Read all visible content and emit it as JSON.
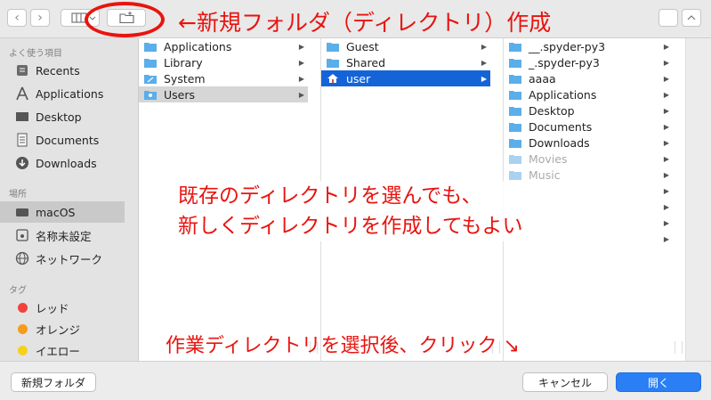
{
  "toolbar": {
    "back_icon": "chevron-left",
    "forward_icon": "chevron-right",
    "view_icon": "columns-view",
    "new_folder_icon": "new-folder"
  },
  "annotations": {
    "new_folder": "←新規フォルダ（ディレクトリ）作成",
    "middle_line1": "既存のディレクトリを選んでも、",
    "middle_line2": "新しくディレクトリを作成してもよい",
    "bottom": "作業ディレクトリを選択後、クリック ↘",
    "color": "#e8140f"
  },
  "sidebar": {
    "favorites_header": "よく使う項目",
    "favorites": [
      {
        "label": "Recents",
        "icon": "clock-icon"
      },
      {
        "label": "Applications",
        "icon": "applications-icon"
      },
      {
        "label": "Desktop",
        "icon": "desktop-icon"
      },
      {
        "label": "Documents",
        "icon": "document-icon"
      },
      {
        "label": "Downloads",
        "icon": "download-icon"
      }
    ],
    "locations_header": "場所",
    "locations": [
      {
        "label": "macOS",
        "icon": "disk-icon",
        "selected": true
      },
      {
        "label": "名称未設定",
        "icon": "disk-icon"
      },
      {
        "label": "ネットワーク",
        "icon": "globe-icon"
      }
    ],
    "tags_header": "タグ",
    "tags": [
      {
        "label": "レッド",
        "color": "#f0433a"
      },
      {
        "label": "オレンジ",
        "color": "#f89a1c"
      },
      {
        "label": "イエロー",
        "color": "#f6d11c"
      }
    ]
  },
  "columns": {
    "col1": [
      {
        "label": "Applications",
        "icon": "applications-icon",
        "arrow": true
      },
      {
        "label": "Library",
        "icon": "folder-icon",
        "arrow": true
      },
      {
        "label": "System",
        "icon": "system-icon",
        "arrow": true
      },
      {
        "label": "Users",
        "icon": "users-icon",
        "arrow": true,
        "state": "gray"
      }
    ],
    "col2": [
      {
        "label": "Guest",
        "icon": "folder-icon",
        "arrow": true
      },
      {
        "label": "Shared",
        "icon": "folder-icon",
        "arrow": true
      },
      {
        "label": "user",
        "icon": "home-icon",
        "arrow": true,
        "state": "selected"
      }
    ],
    "col3": [
      {
        "label": "__.spyder-py3",
        "icon": "folder-icon",
        "arrow": true
      },
      {
        "label": "_.spyder-py3",
        "icon": "folder-icon",
        "arrow": true
      },
      {
        "label": "aaaa",
        "icon": "folder-icon",
        "arrow": true
      },
      {
        "label": "Applications",
        "icon": "folder-icon",
        "arrow": true
      },
      {
        "label": "Desktop",
        "icon": "folder-icon",
        "arrow": true
      },
      {
        "label": "Documents",
        "icon": "folder-icon",
        "arrow": true
      },
      {
        "label": "Downloads",
        "icon": "folder-icon",
        "arrow": true
      },
      {
        "label": "Movies",
        "icon": "folder-icon",
        "arrow": true,
        "state": "dim"
      },
      {
        "label": "Music",
        "icon": "folder-icon",
        "arrow": true,
        "state": "dim"
      },
      {
        "label": "",
        "icon": "",
        "arrow": true
      },
      {
        "label": "",
        "icon": "",
        "arrow": true
      },
      {
        "label": "",
        "icon": "",
        "arrow": true
      },
      {
        "label": "",
        "icon": "",
        "arrow": true
      }
    ]
  },
  "bottom": {
    "new_folder_label": "新規フォルダ",
    "cancel_label": "キャンセル",
    "open_label": "開く"
  }
}
